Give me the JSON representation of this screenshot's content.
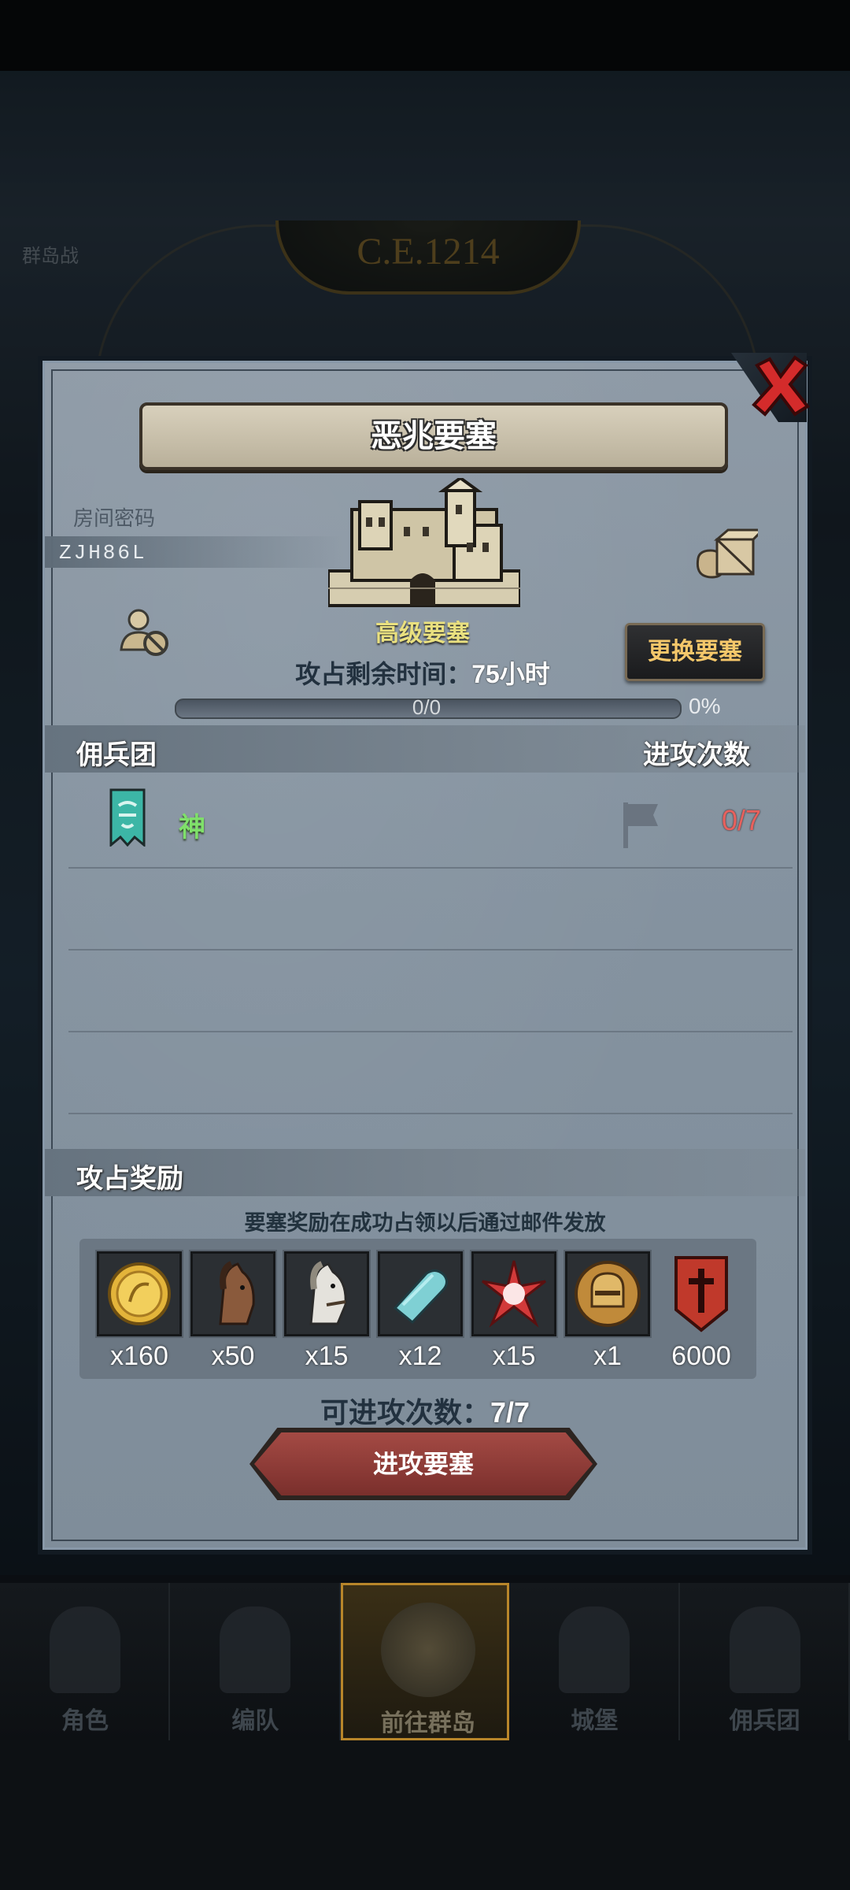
{
  "background": {
    "year": "C.E.1214",
    "side_text": "群岛战"
  },
  "dialog": {
    "title": "恶兆要塞",
    "room_label": "房间密码",
    "room_code": "ZJH86L",
    "fortress_name": "高级要塞",
    "exchange_label": "更换要塞",
    "time_prefix": "攻占剩余时间：",
    "time_value": "75小时",
    "progress_text": "0/0",
    "progress_percent": "0%",
    "progress_fraction": 0,
    "mercenary_header": "佣兵团",
    "attack_count_header": "进攻次数",
    "mercenaries": [
      {
        "name": "神",
        "attack_count": "0/7"
      }
    ],
    "reward_header": "攻占奖励",
    "reward_note": "要塞奖励在成功占领以后通过邮件发放",
    "rewards": [
      {
        "icon": "gold-coin-icon",
        "qty": "x160"
      },
      {
        "icon": "brown-horse-icon",
        "qty": "x50"
      },
      {
        "icon": "white-horse-icon",
        "qty": "x15"
      },
      {
        "icon": "cloth-scroll-icon",
        "qty": "x12"
      },
      {
        "icon": "red-star-shard-icon",
        "qty": "x15"
      },
      {
        "icon": "knight-helmet-coin-icon",
        "qty": "x1"
      },
      {
        "icon": "red-shield-banner-icon",
        "qty": "6000"
      }
    ],
    "attempts_prefix": "可进攻次数：",
    "attempts_value": "7/7",
    "attack_button": "进攻要塞"
  },
  "nav": {
    "items": [
      {
        "label": "角色",
        "active": false
      },
      {
        "label": "编队",
        "active": false
      },
      {
        "label": "前往群岛",
        "active": true
      },
      {
        "label": "城堡",
        "active": false
      },
      {
        "label": "佣兵团",
        "active": false
      }
    ]
  },
  "colors": {
    "panel": "#8593a0",
    "accent_gold": "#f5c76a",
    "fortress_name": "#e9e07f",
    "merc_name": "#7fe06a",
    "attack_count": "#e8615d",
    "attack_button": "#8e3c38"
  }
}
